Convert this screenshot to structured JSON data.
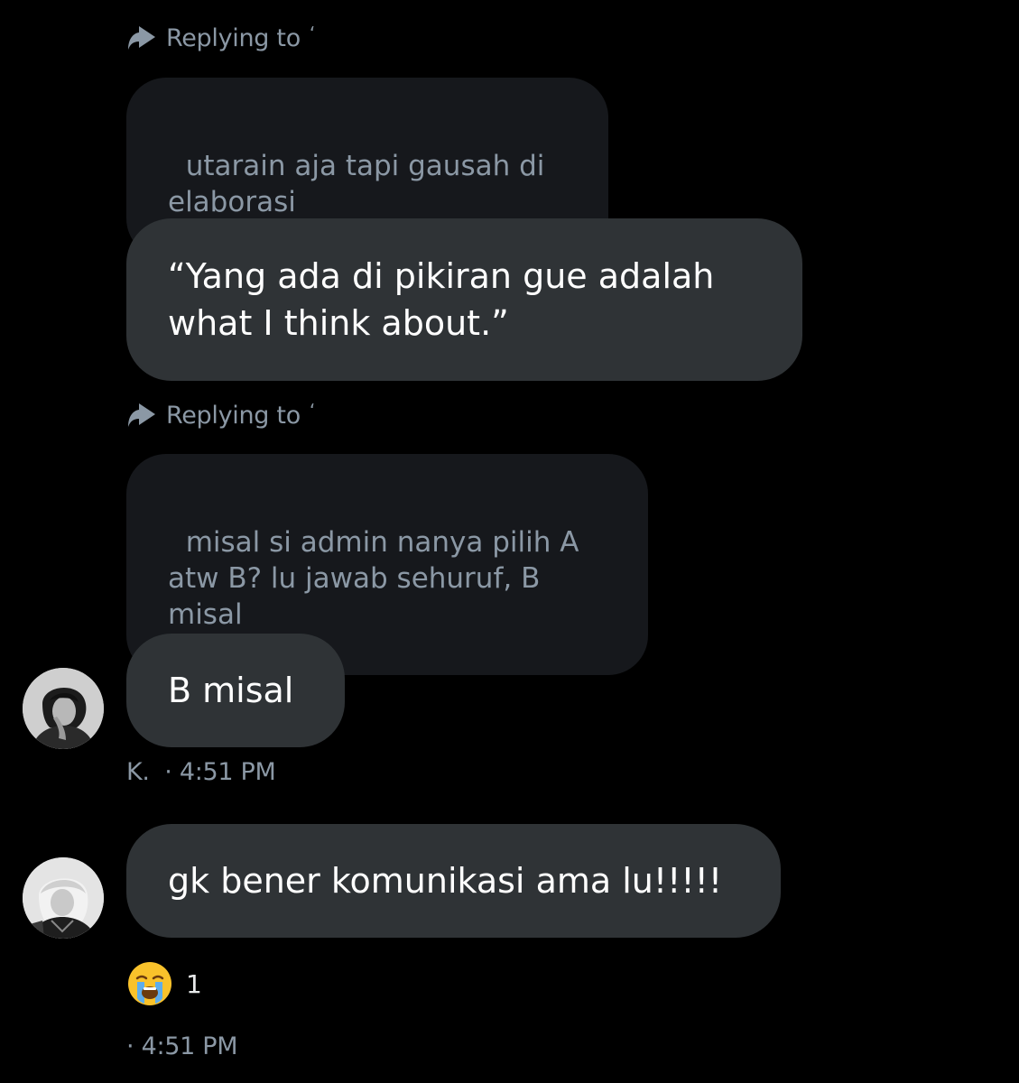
{
  "messages": [
    {
      "reply_label": "Replying to",
      "reply_target": "‘",
      "quoted_text": "utarain aja tapi gausah di\nelaborasi",
      "text": "“Yang ada di pikiran gue adalah\nwhat I think about.”"
    },
    {
      "reply_label": "Replying to",
      "reply_target": "‘",
      "quoted_text": "misal si admin nanya pilih A\natw B? lu jawab sehuruf, B\nmisal",
      "text": "B misal",
      "avatar_icon": "user-avatar-1",
      "meta": "K.  · 4:51 PM"
    },
    {
      "text": "gk bener komunikasi ama lu!!!!!",
      "avatar_icon": "user-avatar-2",
      "reaction": {
        "emoji_icon": "loudly-crying-face-icon",
        "count": "1"
      },
      "meta": "· 4:51 PM"
    }
  ],
  "colors": {
    "background": "#000000",
    "bubble": "#2f3336",
    "quote_bubble": "#16181c",
    "muted_text": "#8b98a5"
  }
}
